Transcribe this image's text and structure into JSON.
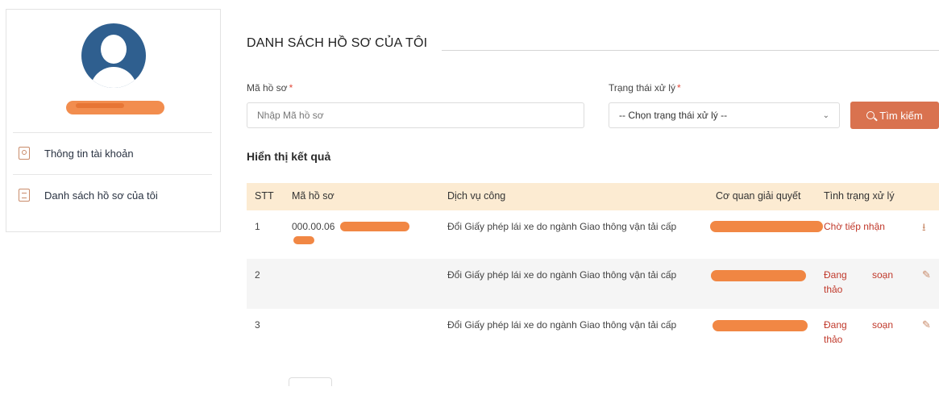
{
  "sidebar": {
    "items": [
      {
        "label": "Thông tin tài khoản",
        "icon": "account-icon"
      },
      {
        "label": "Danh sách hồ sơ của tôi",
        "icon": "list-icon"
      }
    ]
  },
  "main": {
    "title": "DANH SÁCH HỒ SƠ CỦA TÔI",
    "filters": {
      "ma_ho_so_label": "Mã hồ sơ",
      "ma_ho_so_placeholder": "Nhập Mã hồ sơ",
      "trang_thai_label": "Trạng thái xử lý",
      "trang_thai_selected": "-- Chọn trạng thái xử lý --",
      "required_mark": "*",
      "search_button": "Tìm kiếm"
    },
    "results_title": "Hiển thị kết quả",
    "table": {
      "headers": [
        "STT",
        "Mã hồ sơ",
        "Dịch vụ công",
        "Cơ quan giải quyết",
        "Tình trạng xử lý"
      ],
      "rows": [
        {
          "stt": "1",
          "ma_ho_so": "000.00.06",
          "dich_vu": "Đổi Giấy phép lái xe do ngành Giao thông vận tải cấp",
          "status": "Chờ tiếp nhận",
          "action": "download-icon"
        },
        {
          "stt": "2",
          "ma_ho_so": "",
          "dich_vu": "Đổi Giấy phép lái xe do ngành Giao thông vận tải cấp",
          "status_w1": "Đang",
          "status_w2": "soạn",
          "status_w3": "thảo",
          "action": "edit-icon"
        },
        {
          "stt": "3",
          "ma_ho_so": "",
          "dich_vu": "Đổi Giấy phép lái xe do ngành Giao thông vận tải cấp",
          "status_w1": "Đang",
          "status_w2": "soạn",
          "status_w3": "thảo",
          "action": "edit-icon"
        }
      ]
    }
  },
  "colors": {
    "accent": "#d9724f",
    "header_bg": "#fcebd2",
    "status_text": "#c0392b",
    "avatar": "#2f5f8f",
    "redaction": "#f07a30"
  }
}
